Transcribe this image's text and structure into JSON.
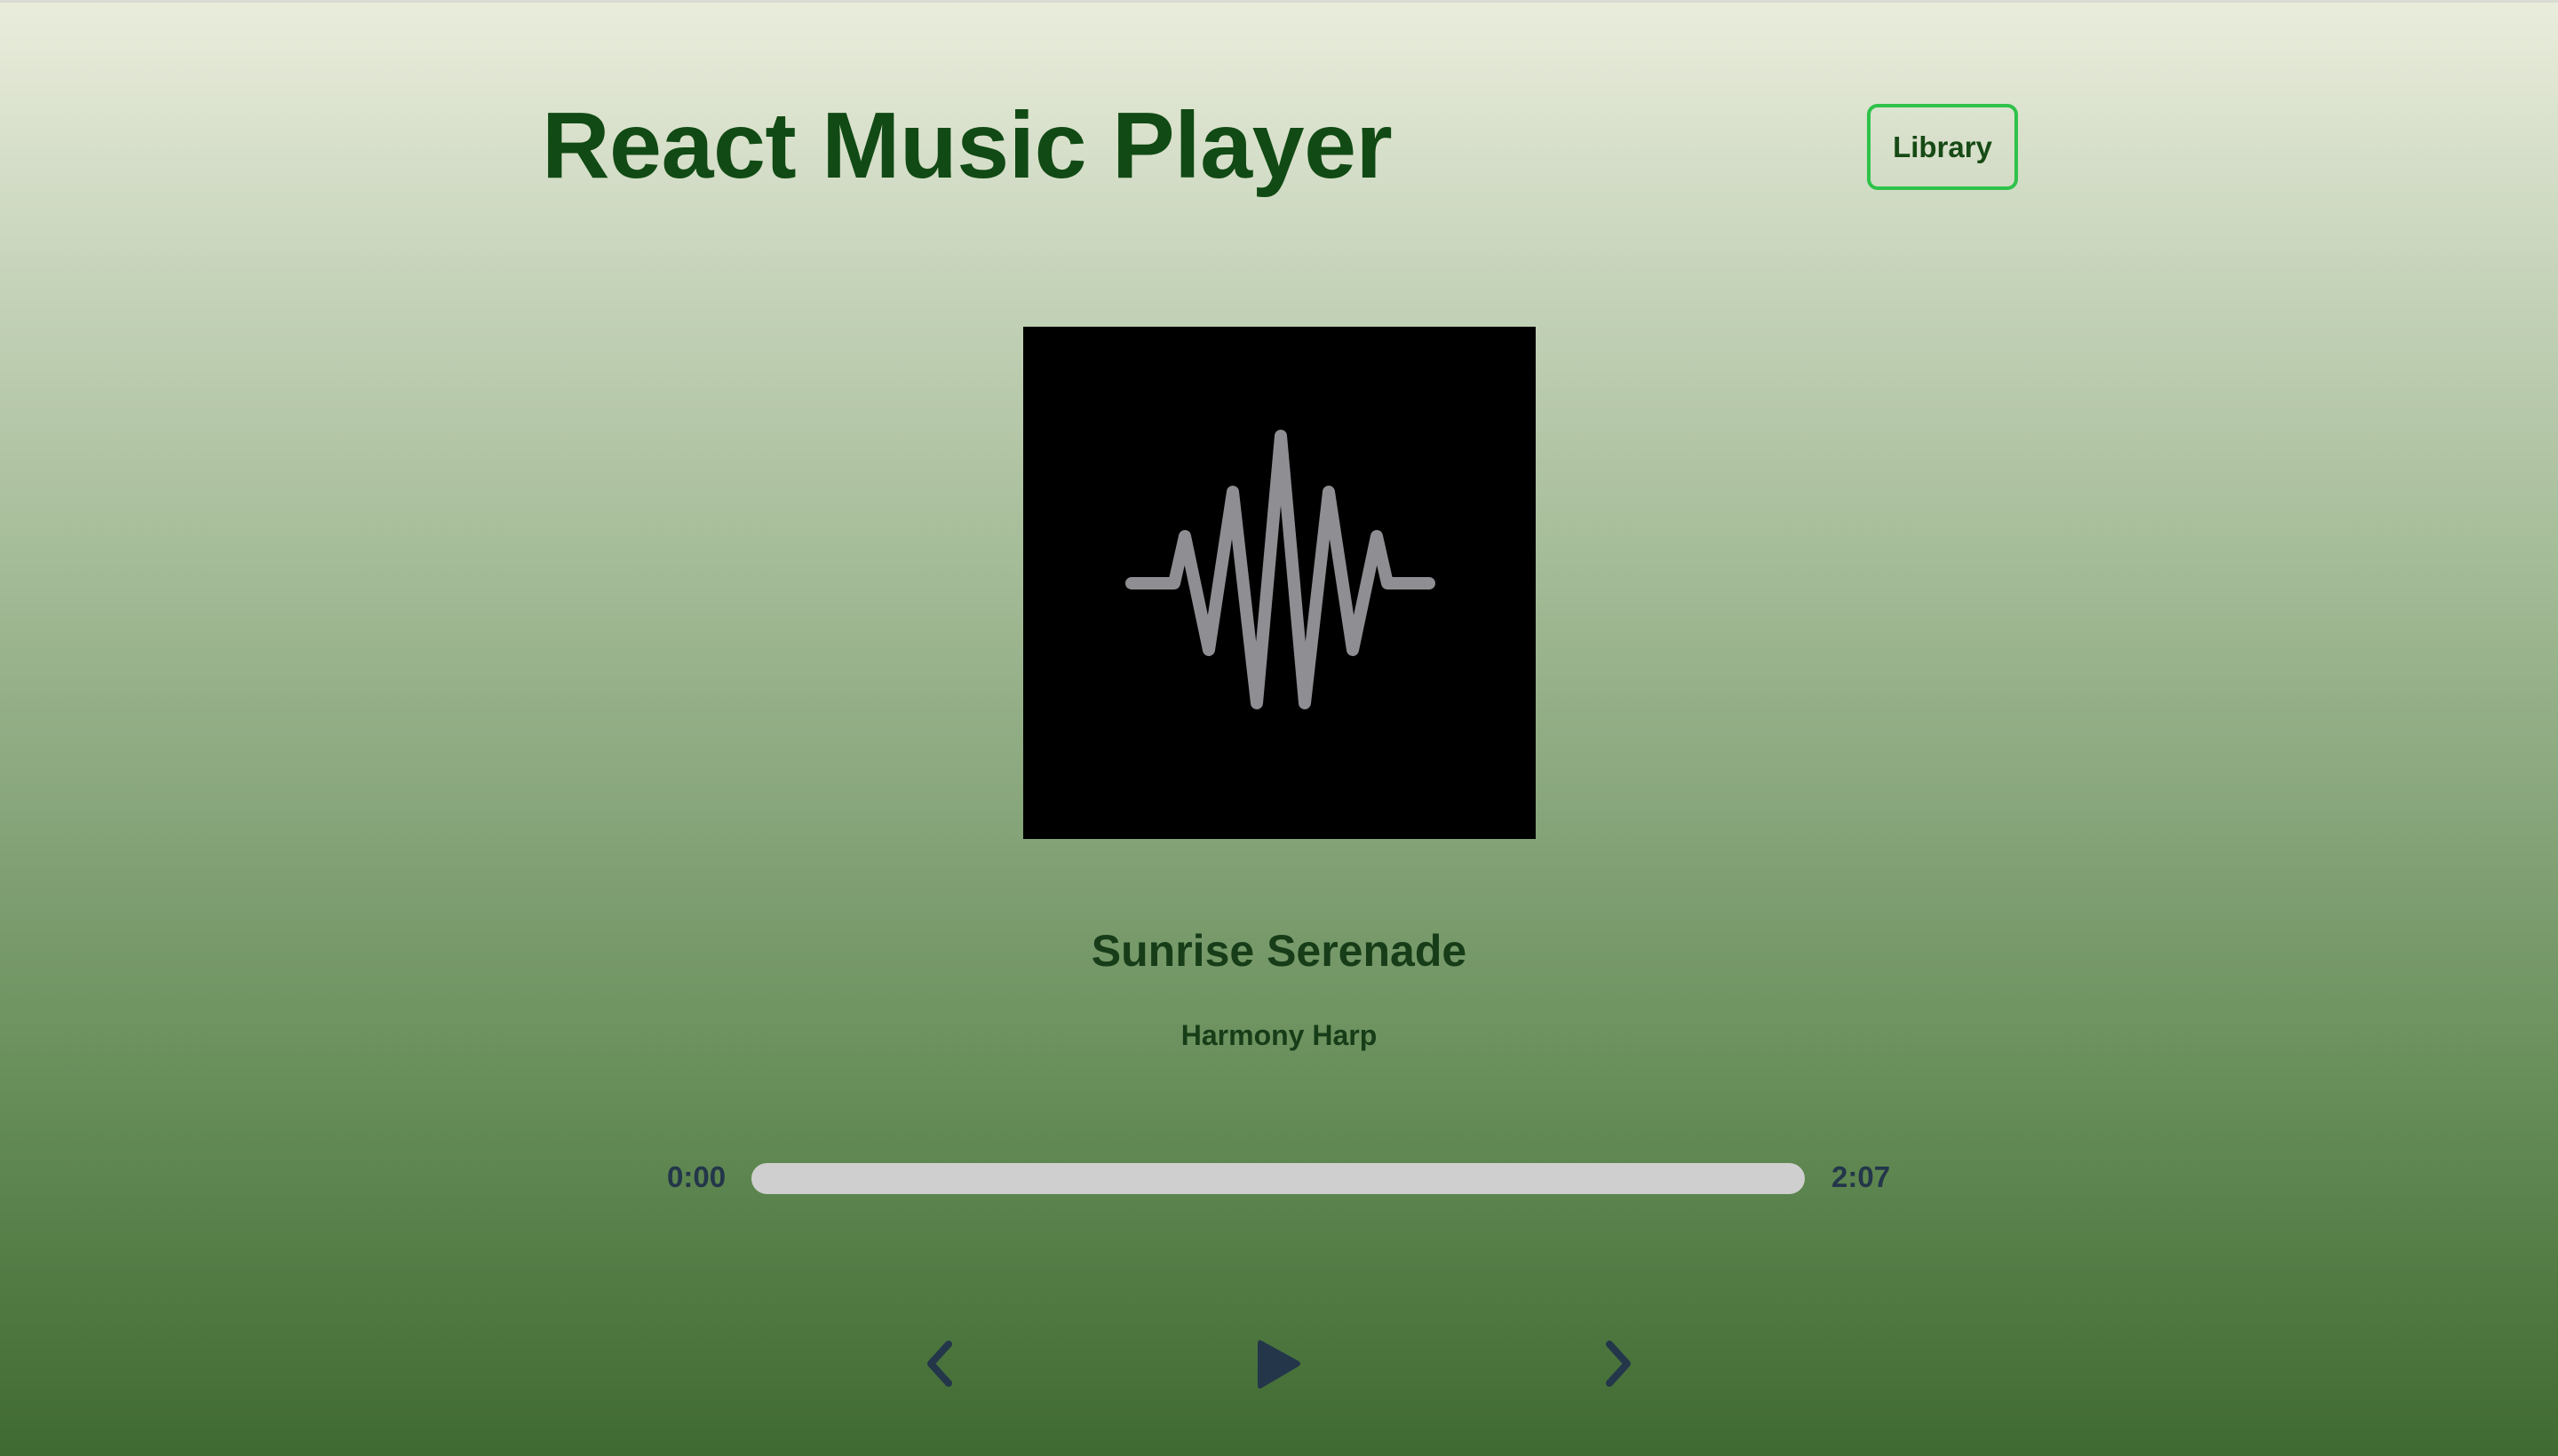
{
  "header": {
    "title": "React Music Player",
    "library_label": "Library"
  },
  "song": {
    "title": "Sunrise Serenade",
    "artist": "Harmony Harp",
    "cover_icon": "waveform-icon"
  },
  "playback": {
    "current_time": "0:00",
    "total_time": "2:07",
    "progress_fraction": 0
  },
  "controls": {
    "prev_icon": "chevron-left-icon",
    "play_icon": "play-icon",
    "next_icon": "chevron-right-icon"
  },
  "colors": {
    "title": "#114a14",
    "library_border": "#2fc24a",
    "track": "#cfcfcf",
    "controls": "#23364a",
    "waveform": "#8e8e93"
  }
}
